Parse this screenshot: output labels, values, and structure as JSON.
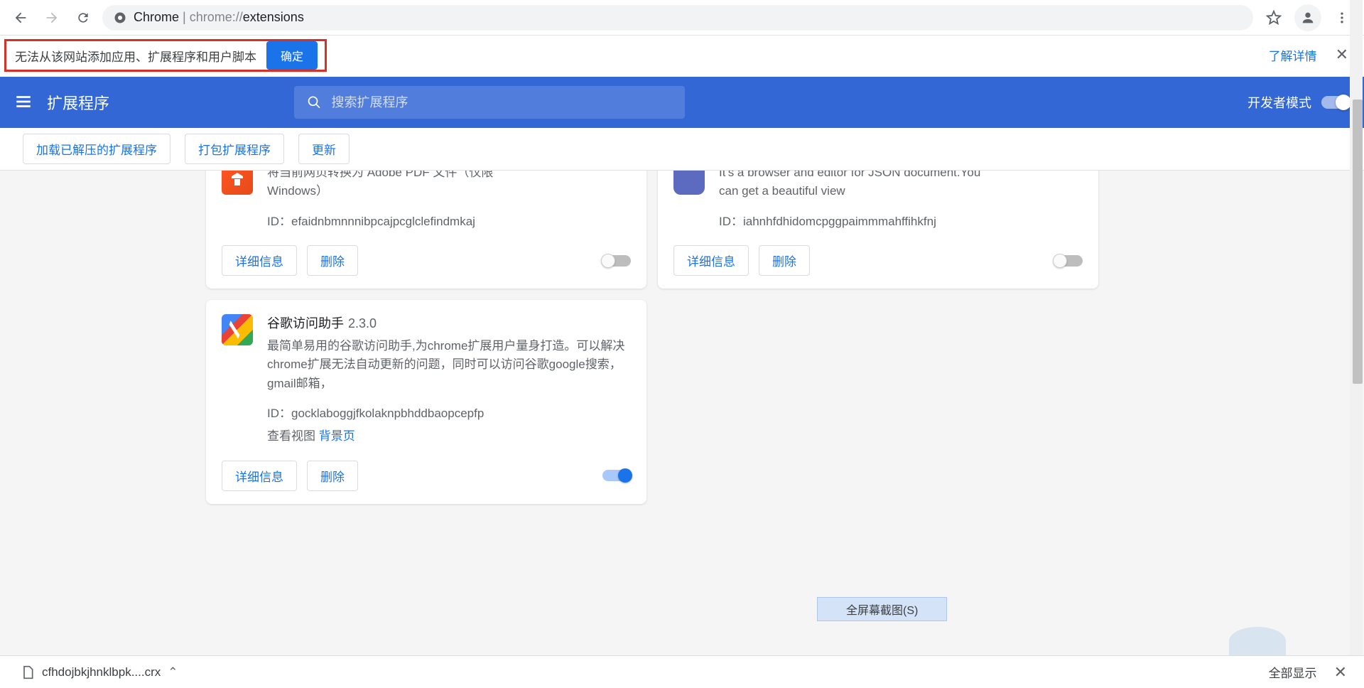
{
  "browser": {
    "url_label": "Chrome",
    "url_prefix": "chrome://",
    "url_page": "extensions"
  },
  "infobar": {
    "message": "无法从该网站添加应用、扩展程序和用户脚本",
    "confirm": "确定",
    "learn_more": "了解详情"
  },
  "header": {
    "title": "扩展程序",
    "search_placeholder": "搜索扩展程序",
    "dev_mode_label": "开发者模式"
  },
  "actions": {
    "load_unpacked": "加载已解压的扩展程序",
    "pack": "打包扩展程序",
    "update": "更新"
  },
  "labels": {
    "details": "详细信息",
    "remove": "删除",
    "id_prefix": "ID：",
    "view_prefix": "查看视图",
    "view_link": "背景页"
  },
  "extensions": [
    {
      "name_partial": "将当前网页转换为 Adobe PDF 文件（仅限",
      "desc_line2": "Windows）",
      "id": "efaidnbmnnnibpcajpcglclefindmkaj",
      "enabled": false,
      "icon": "orange"
    },
    {
      "name_partial": "It's a browser and editor for JSON document.You",
      "desc_line2": "can get a beautiful view",
      "id": "iahnhfdhidomcpggpaimmmahffihkfnj",
      "enabled": false,
      "icon": "blue"
    },
    {
      "name": "谷歌访问助手",
      "version": "2.3.0",
      "desc": "最简单易用的谷歌访问助手,为chrome扩展用户量身打造。可以解决chrome扩展无法自动更新的问题，同时可以访问谷歌google搜索，gmail邮箱，",
      "id": "gocklaboggjfkolaknpbhddbaopcepfp",
      "enabled": true,
      "icon": "rainbow"
    }
  ],
  "overlay_button": "全屏幕截图(S)",
  "downloads": {
    "file": "cfhdojbkjhnklbpk....crx",
    "show_all": "全部显示"
  }
}
